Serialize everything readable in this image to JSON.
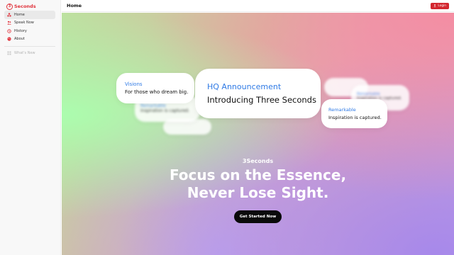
{
  "sidebar": {
    "brand": {
      "logo_text": "3",
      "name": "Seconds"
    },
    "items": [
      {
        "label": "Home",
        "icon": "triangle-shapes-icon",
        "active": true
      },
      {
        "label": "Speak Now",
        "icon": "people-icon"
      },
      {
        "label": "History",
        "icon": "history-icon"
      },
      {
        "label": "About",
        "icon": "globe-icon"
      }
    ],
    "extra": {
      "label": "What's New",
      "icon": "grid-icon"
    }
  },
  "topbar": {
    "title": "Home",
    "login_label": "Login"
  },
  "hero": {
    "cards": {
      "hq": {
        "tag": "HQ Announcement",
        "text": "Introducing Three Seconds"
      },
      "visions": {
        "tag": "Visions",
        "text": "For those who dream big."
      },
      "remarkable": {
        "tag": "Remarkable",
        "text": "Inspiration is captured."
      },
      "blur_left": {
        "tag": "Remarkable",
        "text": "Inspiration is captured."
      },
      "blur_right": {
        "tag": "Remarkable",
        "text": "Inspiration is captured."
      }
    },
    "subtitle": "3Seconds",
    "title_line1": "Focus on the Essence,",
    "title_line2": "Never Lose Sight.",
    "cta_label": "Get Started Now"
  },
  "colors": {
    "brand": "#e0323b",
    "accent": "#2f7ae5",
    "cta": "#0a0a0a"
  }
}
